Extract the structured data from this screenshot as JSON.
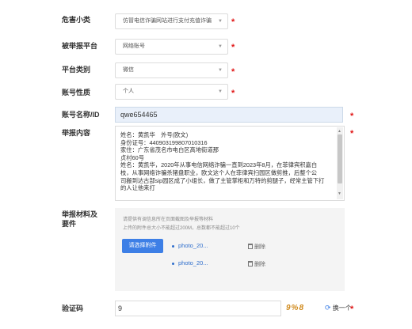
{
  "form": {
    "category": {
      "label": "危害小类",
      "value": "仿冒电信诈骗网站进行支付充值诈骗"
    },
    "platform": {
      "label": "被举报平台",
      "value": "网络账号"
    },
    "platform_type": {
      "label": "平台类别",
      "value": "微信"
    },
    "account_nature": {
      "label": "账号性质",
      "value": "个人"
    },
    "account_name": {
      "label": "账号名称/ID",
      "value": "qwe654465"
    },
    "content": {
      "label": "举报内容",
      "lines": [
        "姓名：黄凯华　外号(欧文)",
        "身份证号：440903199807010316",
        "家住：广东省茂名市电白区高地街道那",
        "贞村60号",
        "姓名：黄凯华，2020年从事电信网络诈骗一直到2023年8月，在菲律宾积嘉白",
        "枝，从事网络诈骗杀猪盘职业，欧文这个人在菲律宾扫园区做剪推，后整个公",
        "司搬到达古部sip园区成了小组长，做了主管掌柜和万特的剪腿子，经常主管下打",
        "的人让他来打"
      ]
    },
    "attachments": {
      "label_line1": "举报材料及",
      "label_line2": "要件",
      "hint1": "请提供有调信息所在页面截图及举报等材料",
      "hint2": "上传的附件总大小不能超过200M，总数都不能超过10个",
      "upload_button": "请选择附件",
      "files": [
        {
          "name": "photo_20...",
          "delete": "删除"
        },
        {
          "name": "photo_20...",
          "delete": "删除"
        }
      ]
    },
    "captcha": {
      "label": "验证码",
      "value": "9",
      "image_text": "9%8",
      "refresh": "换一个"
    },
    "required_mark": "*"
  },
  "colors": {
    "accent": "#3d7fe6",
    "required": "#e01515",
    "link": "#2f6ecc"
  }
}
